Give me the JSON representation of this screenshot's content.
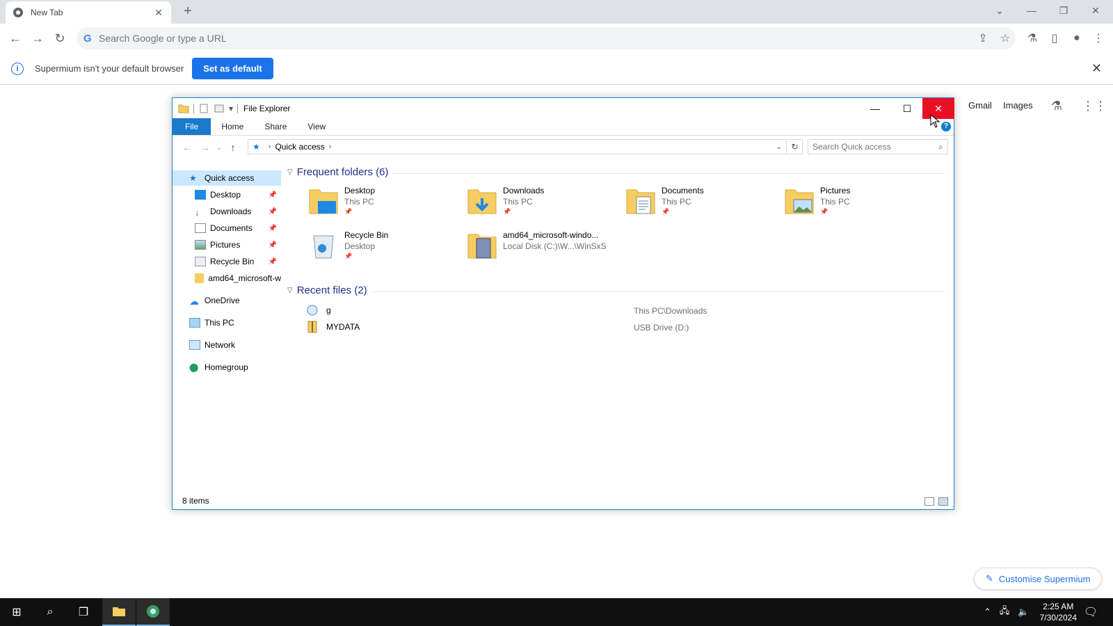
{
  "browser": {
    "tab_title": "New Tab",
    "omnibox_placeholder": "Search Google or type a URL",
    "infobar_message": "Supermium isn't your default browser",
    "set_default_label": "Set as default",
    "ntp_links": [
      "Gmail",
      "Images"
    ],
    "customise_label": "Customise Supermium"
  },
  "explorer": {
    "window_title": "File Explorer",
    "ribbon_tabs": [
      "File",
      "Home",
      "Share",
      "View"
    ],
    "breadcrumb": "Quick access",
    "search_placeholder": "Search Quick access",
    "nav": {
      "quick_access": "Quick access",
      "pinned": [
        "Desktop",
        "Downloads",
        "Documents",
        "Pictures",
        "Recycle Bin",
        "amd64_microsoft-w"
      ],
      "onedrive": "OneDrive",
      "this_pc": "This PC",
      "network": "Network",
      "homegroup": "Homegroup"
    },
    "frequent_header": "Frequent folders (6)",
    "frequent": [
      {
        "name": "Desktop",
        "location": "This PC"
      },
      {
        "name": "Downloads",
        "location": "This PC"
      },
      {
        "name": "Documents",
        "location": "This PC"
      },
      {
        "name": "Pictures",
        "location": "This PC"
      },
      {
        "name": "Recycle Bin",
        "location": "Desktop"
      },
      {
        "name": "amd64_microsoft-windo...",
        "location": "Local Disk (C:)\\W...\\WinSxS"
      }
    ],
    "recent_header": "Recent files (2)",
    "recent": [
      {
        "name": "g",
        "path": "This PC\\Downloads"
      },
      {
        "name": "MYDATA",
        "path": "USB Drive (D:)"
      }
    ],
    "status": "8 items"
  },
  "taskbar": {
    "time": "2:25 AM",
    "date": "7/30/2024"
  },
  "colors": {
    "accent": "#1a73e8",
    "explorer_blue": "#1979ca",
    "close_red": "#e81123",
    "folder_yellow": "#f5cd62"
  }
}
